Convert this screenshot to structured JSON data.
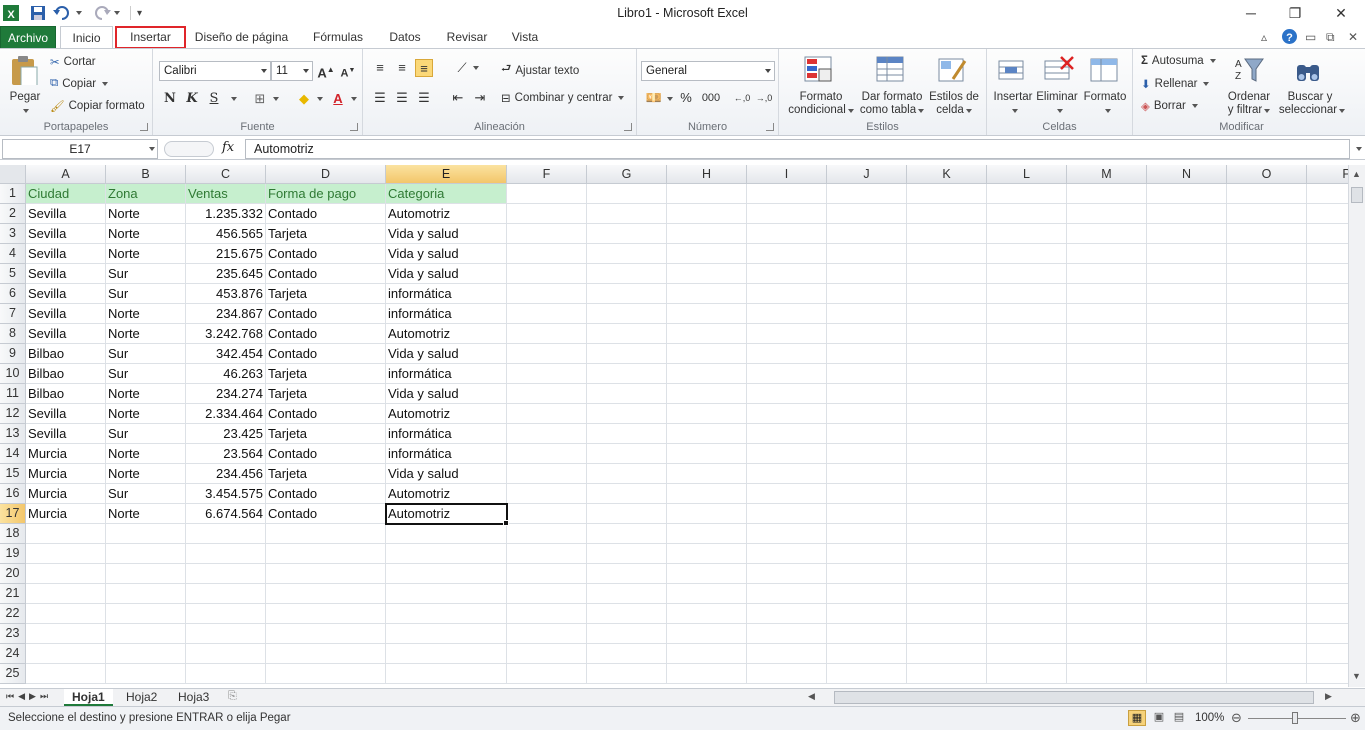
{
  "window": {
    "title": "Libro1  -  Microsoft Excel",
    "app_icon": "excel-icon"
  },
  "tabs": {
    "file": "Archivo",
    "items": [
      "Inicio",
      "Insertar",
      "Diseño de página",
      "Fórmulas",
      "Datos",
      "Revisar",
      "Vista"
    ],
    "active": "Inicio",
    "highlighted": "Insertar"
  },
  "ribbon": {
    "clipboard": {
      "label": "Portapapeles",
      "paste": "Pegar",
      "cut": "Cortar",
      "copy": "Copiar",
      "format_painter": "Copiar formato"
    },
    "font": {
      "label": "Fuente",
      "font_name": "Calibri",
      "font_size": "11",
      "bold": "N",
      "italic": "K",
      "underline": "S"
    },
    "alignment": {
      "label": "Alineación",
      "wrap_text": "Ajustar texto",
      "merge_center": "Combinar y centrar"
    },
    "number": {
      "label": "Número",
      "format": "General",
      "percent": "%",
      "thousands": "000",
      "inc_decimal": "←,0 ,00",
      "dec_decimal": ",00 →,0"
    },
    "styles": {
      "label": "Estilos",
      "conditional_1": "Formato",
      "conditional_2": "condicional",
      "table_1": "Dar formato",
      "table_2": "como tabla",
      "cell_1": "Estilos de",
      "cell_2": "celda"
    },
    "cells": {
      "label": "Celdas",
      "insert": "Insertar",
      "delete": "Eliminar",
      "format": "Formato"
    },
    "editing": {
      "label": "Modificar",
      "autosum": "Autosuma",
      "fill": "Rellenar",
      "clear": "Borrar",
      "sort_1": "Ordenar",
      "sort_2": "y filtrar",
      "find_1": "Buscar y",
      "find_2": "seleccionar"
    }
  },
  "formula_bar": {
    "name_box": "E17",
    "fx": "fx",
    "value": "Automotriz"
  },
  "columns": [
    "A",
    "B",
    "C",
    "D",
    "E",
    "F",
    "G",
    "H",
    "I",
    "J",
    "K",
    "L",
    "M",
    "N",
    "O",
    "P"
  ],
  "selected_column": "E",
  "selected_row": 17,
  "row_numbers": [
    1,
    2,
    3,
    4,
    5,
    6,
    7,
    8,
    9,
    10,
    11,
    12,
    13,
    14,
    15,
    16,
    17,
    18,
    19,
    20,
    21,
    22,
    23,
    24,
    25
  ],
  "header_row": [
    "Ciudad",
    "Zona",
    "Ventas",
    "Forma de pago",
    "Categoria"
  ],
  "rows": [
    [
      "Sevilla",
      "Norte",
      "1.235.332",
      "Contado",
      "Automotriz"
    ],
    [
      "Sevilla",
      "Norte",
      "456.565",
      "Tarjeta",
      "Vida y salud"
    ],
    [
      "Sevilla",
      "Norte",
      "215.675",
      "Contado",
      "Vida y salud"
    ],
    [
      "Sevilla",
      "Sur",
      "235.645",
      "Contado",
      "Vida y salud"
    ],
    [
      "Sevilla",
      "Sur",
      "453.876",
      "Tarjeta",
      "informática"
    ],
    [
      "Sevilla",
      "Norte",
      "234.867",
      "Contado",
      "informática"
    ],
    [
      "Sevilla",
      "Norte",
      "3.242.768",
      "Contado",
      "Automotriz"
    ],
    [
      "Bilbao",
      "Sur",
      "342.454",
      "Contado",
      "Vida y salud"
    ],
    [
      "Bilbao",
      "Sur",
      "46.263",
      "Tarjeta",
      "informática"
    ],
    [
      "Bilbao",
      "Norte",
      "234.274",
      "Tarjeta",
      "Vida y salud"
    ],
    [
      "Sevilla",
      "Norte",
      "2.334.464",
      "Contado",
      "Automotriz"
    ],
    [
      "Sevilla",
      "Sur",
      "23.425",
      "Tarjeta",
      "informática"
    ],
    [
      "Murcia",
      "Norte",
      "23.564",
      "Contado",
      "informática"
    ],
    [
      "Murcia",
      "Norte",
      "234.456",
      "Tarjeta",
      "Vida y salud"
    ],
    [
      "Murcia",
      "Sur",
      "3.454.575",
      "Contado",
      "Automotriz"
    ],
    [
      "Murcia",
      "Norte",
      "6.674.564",
      "Contado",
      "Automotriz"
    ]
  ],
  "sheets": [
    "Hoja1",
    "Hoja2",
    "Hoja3"
  ],
  "active_sheet": "Hoja1",
  "status": {
    "message": "Seleccione el destino y presione ENTRAR o elija Pegar",
    "zoom": "100%"
  },
  "colors": {
    "excel_green": "#1f7a3a",
    "header_fill": "#c6efce",
    "header_text": "#2f7a34",
    "highlight": "#e0252a"
  }
}
